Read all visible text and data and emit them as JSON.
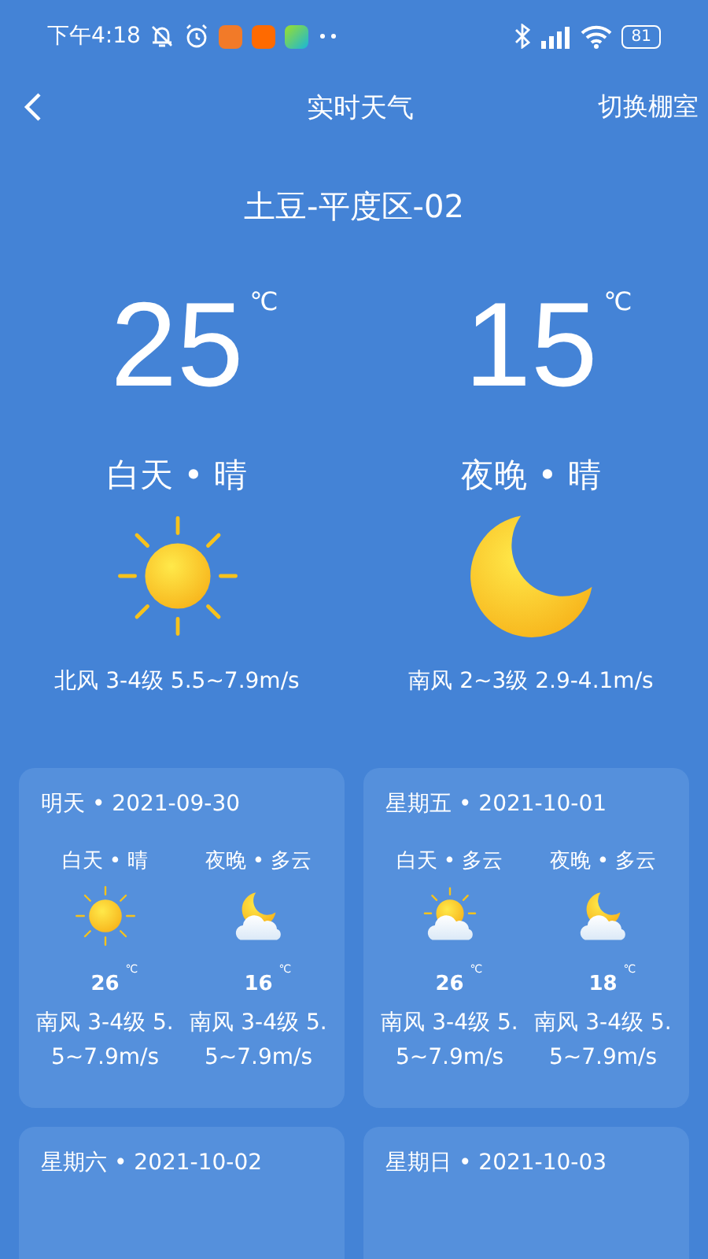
{
  "status_bar": {
    "time": "下午4:18",
    "battery": "81"
  },
  "nav": {
    "title": "实时天气",
    "action": "切换棚室"
  },
  "location": "土豆-平度区-02",
  "current": [
    {
      "temp": "25",
      "unit": "℃",
      "condition": "白天 • 晴",
      "kind": "sunny",
      "wind": "北风 3-4级 5.5~7.9m/s"
    },
    {
      "temp": "15",
      "unit": "℃",
      "condition": "夜晚 • 晴",
      "kind": "clear_night",
      "wind": "南风 2~3级 2.9-4.1m/s"
    }
  ],
  "forecast": [
    {
      "title": "明天 • 2021-09-30",
      "periods": [
        {
          "label": "白天 • 晴",
          "kind": "sunny",
          "temp": "26",
          "unit": "℃",
          "wind": "南风 3-4级 5.5~7.9m/s"
        },
        {
          "label": "夜晚 • 多云",
          "kind": "cloudy_night",
          "temp": "16",
          "unit": "℃",
          "wind": "南风 3-4级 5.5~7.9m/s"
        }
      ]
    },
    {
      "title": "星期五 • 2021-10-01",
      "periods": [
        {
          "label": "白天 • 多云",
          "kind": "cloudy_day",
          "temp": "26",
          "unit": "℃",
          "wind": "南风 3-4级 5.5~7.9m/s"
        },
        {
          "label": "夜晚 • 多云",
          "kind": "cloudy_night",
          "temp": "18",
          "unit": "℃",
          "wind": "南风 3-4级 5.5~7.9m/s"
        }
      ]
    },
    {
      "title": "星期六 • 2021-10-02"
    },
    {
      "title": "星期日 • 2021-10-03"
    }
  ]
}
